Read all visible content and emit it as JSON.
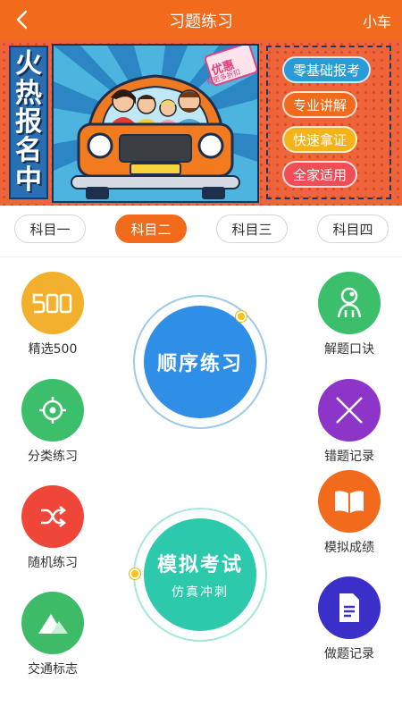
{
  "header": {
    "title": "习题练习",
    "right": "小车"
  },
  "banner": {
    "left_chars": [
      "火",
      "热",
      "报",
      "名",
      "中"
    ],
    "badge_line1": "优惠",
    "badge_line2": "有更多折扣",
    "tags": [
      "零基础报考",
      "专业讲解",
      "快速拿证",
      "全家适用"
    ]
  },
  "tabs": [
    "科目一",
    "科目二",
    "科目三",
    "科目四"
  ],
  "active_tab": "科目二",
  "left_features": [
    {
      "label": "精选500",
      "color": "#f2b02c",
      "icon": "500-icon"
    },
    {
      "label": "分类练习",
      "color": "#3bbf6a",
      "icon": "target-icon"
    },
    {
      "label": "随机练习",
      "color": "#f0463a",
      "icon": "shuffle-icon"
    },
    {
      "label": "交通标志",
      "color": "#3dbb66",
      "icon": "mountain-icon"
    }
  ],
  "right_features": [
    {
      "label": "解题口诀",
      "color": "#3bbf6a",
      "icon": "person-idea-icon"
    },
    {
      "label": "错题记录",
      "color": "#8e35c9",
      "icon": "cross-icon"
    },
    {
      "label": "模拟成绩",
      "color": "#f26a1b",
      "icon": "book-icon"
    },
    {
      "label": "做题记录",
      "color": "#3b2fc9",
      "icon": "document-icon"
    }
  ],
  "big_buttons": {
    "sequence": {
      "title": "顺序练习",
      "color": "#2f8fe6"
    },
    "exam": {
      "title": "模拟考试",
      "subtitle": "仿真冲刺",
      "color": "#2cc9ad"
    }
  }
}
